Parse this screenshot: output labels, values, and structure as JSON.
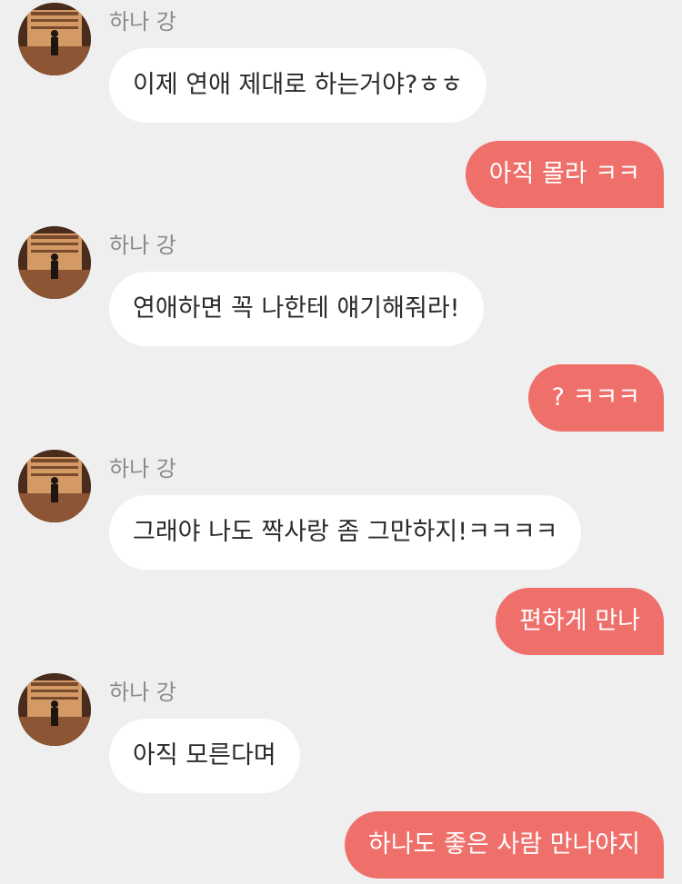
{
  "messages": [
    {
      "direction": "incoming",
      "sender": "하나 강",
      "text": "이제 연애 제대로 하는거야?ㅎㅎ"
    },
    {
      "direction": "outgoing",
      "text": "아직 몰라 ㅋㅋ"
    },
    {
      "direction": "incoming",
      "sender": "하나 강",
      "text": "연애하면 꼭 나한테 얘기해줘라!"
    },
    {
      "direction": "outgoing",
      "text": "? ㅋㅋㅋ"
    },
    {
      "direction": "incoming",
      "sender": "하나 강",
      "text": "그래야 나도 짝사랑 좀 그만하지!ㅋㅋㅋㅋ"
    },
    {
      "direction": "outgoing",
      "text": "편하게 만나"
    },
    {
      "direction": "incoming",
      "sender": "하나 강",
      "text": "아직 모른다며"
    },
    {
      "direction": "outgoing",
      "text": "하나도 좋은 사람 만나야지"
    }
  ],
  "colors": {
    "background": "#efefef",
    "incoming_bubble": "#ffffff",
    "outgoing_bubble": "#ef706b",
    "sender_name": "#8a8a8a"
  },
  "icons": {
    "avatar": "avatar-photo-person-silhouette"
  }
}
